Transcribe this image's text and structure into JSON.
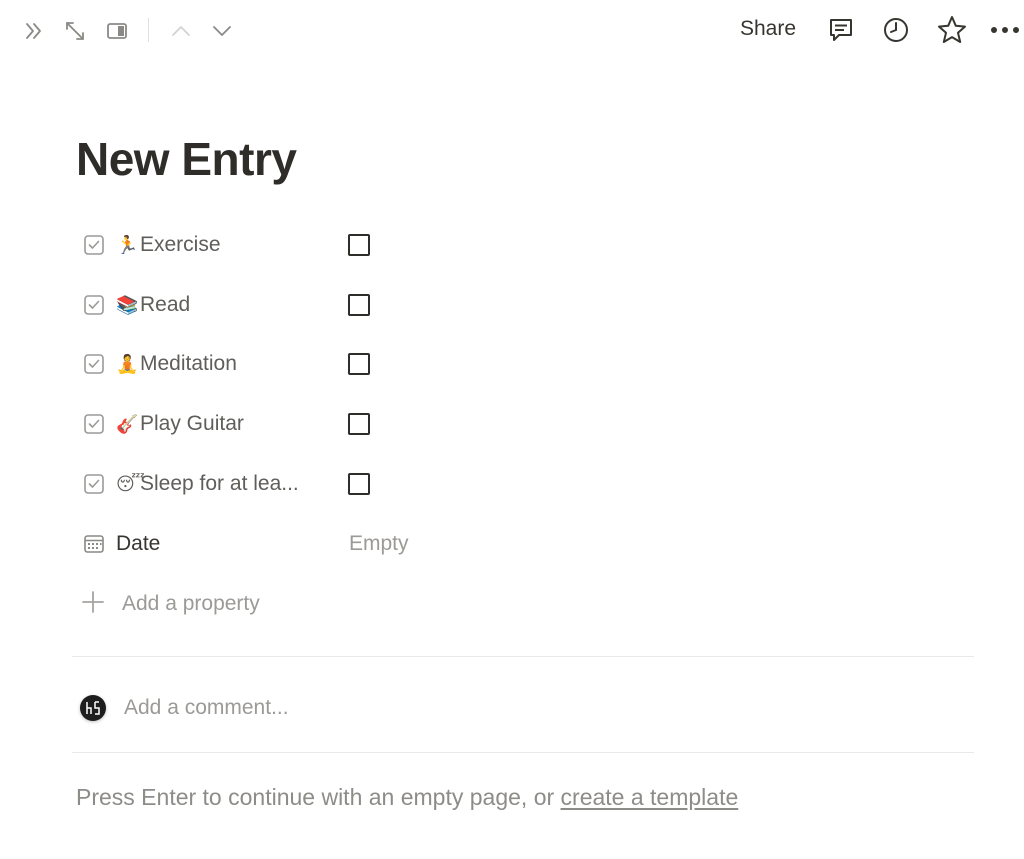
{
  "topbar": {
    "share_label": "Share",
    "icons": [
      "double-chevron-right-icon",
      "expand-icon",
      "side-peek-icon",
      "chevron-up-icon",
      "chevron-down-icon",
      "comment-icon",
      "clock-icon",
      "star-icon",
      "more-icon"
    ]
  },
  "page": {
    "title": "New Entry"
  },
  "properties": [
    {
      "emoji": "🏃",
      "name": "Exercise",
      "type": "checkbox",
      "checked": false
    },
    {
      "emoji": "📚",
      "name": "Read",
      "type": "checkbox",
      "checked": false
    },
    {
      "emoji": "🧘",
      "name": "Meditation",
      "type": "checkbox",
      "checked": false
    },
    {
      "emoji": "🎸",
      "name": "Play Guitar",
      "type": "checkbox",
      "checked": false
    },
    {
      "emoji": "😴",
      "name": "Sleep for at lea...",
      "type": "checkbox",
      "checked": false
    }
  ],
  "date_property": {
    "name": "Date",
    "value": "Empty"
  },
  "add_property_label": "Add a property",
  "comment": {
    "placeholder": "Add a comment..."
  },
  "footer": {
    "hint_prefix": "Press Enter to continue with an empty page, or ",
    "hint_link": "create a template"
  },
  "colors": {
    "text": "#37352f",
    "muted": "#9b9a97",
    "divider": "#e9e9e7"
  }
}
